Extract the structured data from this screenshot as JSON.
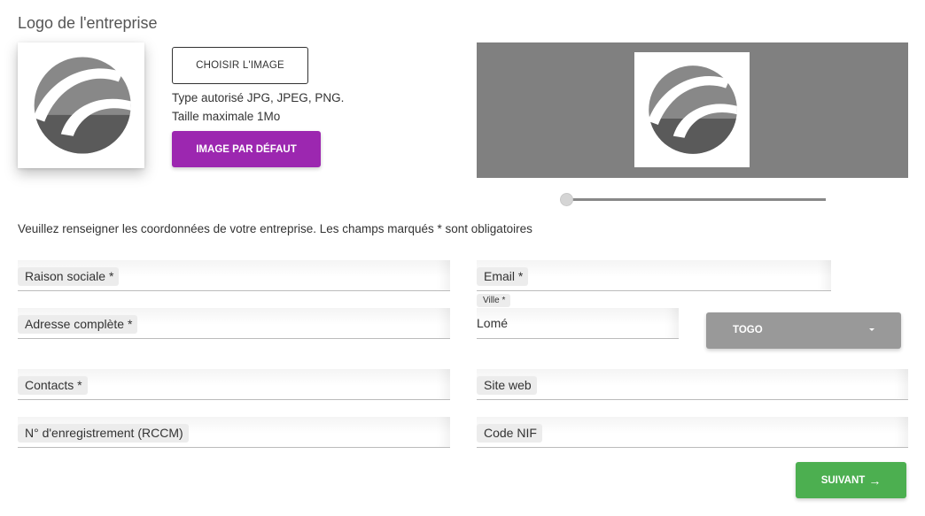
{
  "logo_section": {
    "title": "Logo de l'entreprise",
    "logo_icon": "company-logo-icon",
    "choose_button": "CHOISIR L'IMAGE",
    "allowed_types": "Type autorisé JPG, JPEG, PNG.",
    "max_size": "Taille maximale 1Mo",
    "default_button": "IMAGE PAR DÉFAUT",
    "default_button_color": "#9c27b0",
    "zoom_slider": {
      "value": 0,
      "track_color": "#888888"
    }
  },
  "form": {
    "instructions": "Veuillez renseigner les coordonnées de votre entreprise. Les champs marqués * sont obligatoires",
    "raison_sociale": {
      "label": "Raison sociale *",
      "value": ""
    },
    "email": {
      "label": "Email *",
      "value": ""
    },
    "adresse": {
      "label": "Adresse complète *",
      "value": ""
    },
    "ville": {
      "label": "Ville *",
      "value": "Lomé"
    },
    "pays": {
      "selected": "TOGO",
      "icon": "caret-down-icon",
      "color": "#999999"
    },
    "contacts": {
      "label": "Contacts *",
      "value": ""
    },
    "site_web": {
      "label": "Site web",
      "value": ""
    },
    "rccm": {
      "label": "N° d'enregistrement (RCCM)",
      "value": ""
    },
    "code_nif": {
      "label": "Code NIF",
      "value": ""
    }
  },
  "footer": {
    "next_button": "SUIVANT",
    "next_icon": "→",
    "next_button_color": "#4caf50"
  }
}
